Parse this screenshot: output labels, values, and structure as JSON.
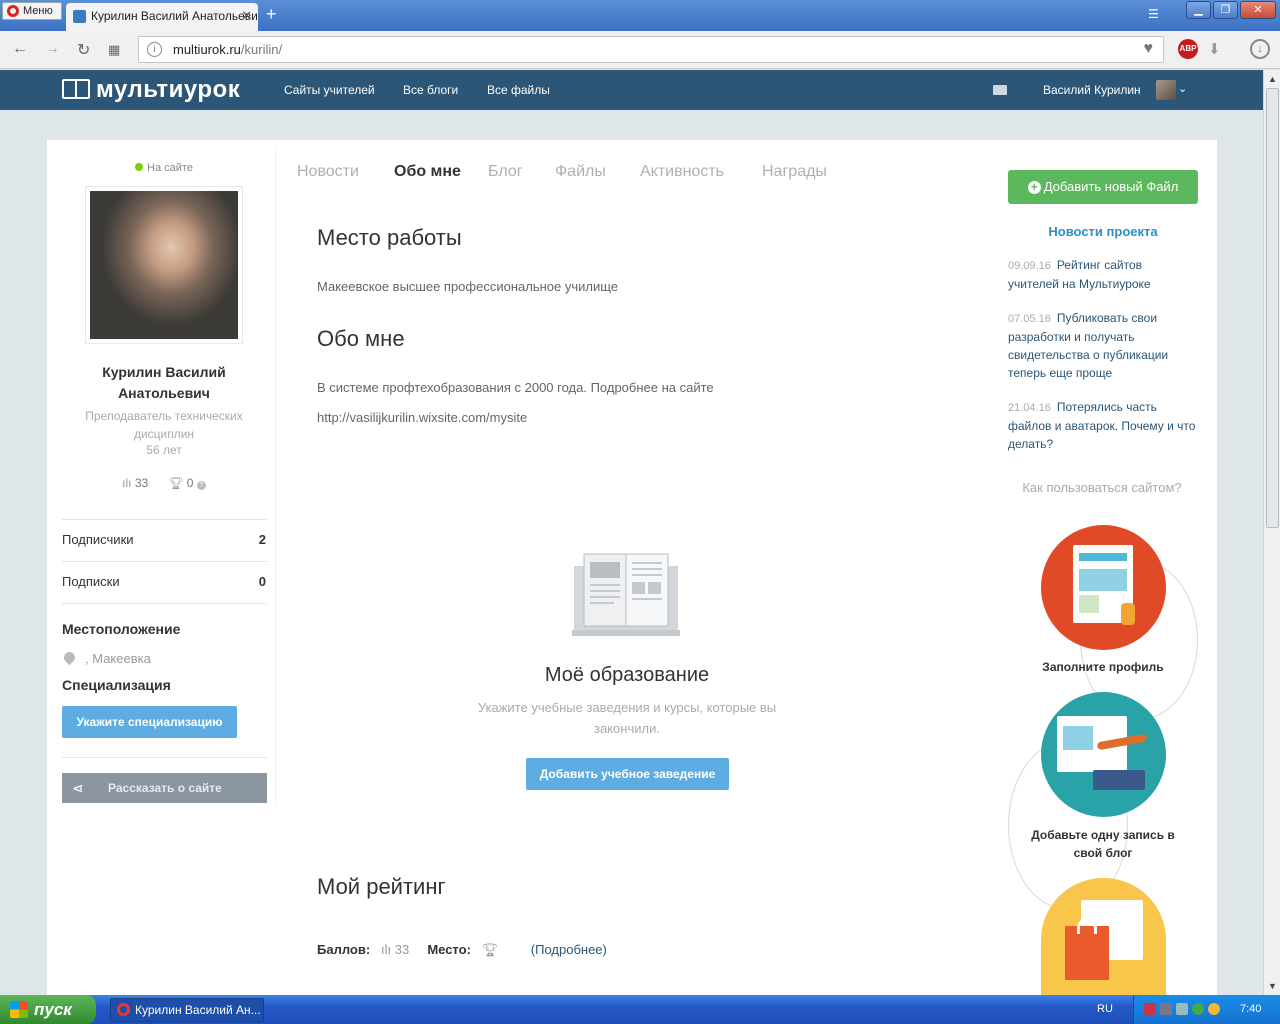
{
  "browser": {
    "menu_label": "Меню",
    "tab_title": "Курилин Василий Анатольевич",
    "url_host": "multiurok.ru",
    "url_path": "/kurilin/",
    "abp_label": "ABP"
  },
  "site": {
    "logo": "мультиурок",
    "nav": [
      "Сайты учителей",
      "Все блоги",
      "Все файлы"
    ],
    "user_name": "Василий Курилин"
  },
  "profile": {
    "status": "На сайте",
    "full_name": "Курилин Василий Анатольевич",
    "position": "Преподаватель технических дисциплин",
    "age": "56 лет",
    "rating_points": "33",
    "awards": "0",
    "subscribers_label": "Подписчики",
    "subscribers_count": "2",
    "subscriptions_label": "Подписки",
    "subscriptions_count": "0",
    "location_heading": "Местоположение",
    "location": ", Макеевка",
    "specialization_heading": "Специализация",
    "specialization_button": "Укажите специализацию",
    "share_button": "Рассказать о сайте"
  },
  "tabs": [
    "Новости",
    "Обо мне",
    "Блог",
    "Файлы",
    "Активность",
    "Награды"
  ],
  "active_tab": "Обо мне",
  "main": {
    "work_heading": "Место работы",
    "work_text": "Макеевское высшее профессиональное училище",
    "about_heading": "Обо мне",
    "about_text": "В системе профтехобразования с 2000 года. Подробнее на сайте",
    "about_link": "http://vasilijkurilin.wixsite.com/mysite",
    "education_title": "Моё образование",
    "education_text": "Укажите учебные заведения и курсы, которые вы закончили.",
    "education_button": "Добавить учебное заведение",
    "rating_heading": "Мой рейтинг",
    "points_label": "Баллов:",
    "points_value": "33",
    "place_label": "Место:",
    "details_link": "(Подробнее)"
  },
  "sidebar": {
    "add_file_button": "Добавить новый Файл",
    "news_title": "Новости проекта",
    "news": [
      {
        "date": "09.09.16",
        "text": "Рейтинг сайтов учителей на Мультиуроке"
      },
      {
        "date": "07.05.16",
        "text": "Публиковать свои разработки и получать свидетельства о публикации теперь еще проще"
      },
      {
        "date": "21.04.16",
        "text": "Потерялись часть файлов и аватарок. Почему и что делать?"
      }
    ],
    "howto_link": "Как пользоваться сайтом?",
    "steps": [
      "Заполните профиль",
      "Добавьте одну запись в свой блог"
    ]
  },
  "taskbar": {
    "start_label": "пуск",
    "task_item": "Курилин Василий Ан...",
    "lang": "RU",
    "clock": "7:40"
  },
  "colors": {
    "header_bg": "#2b5677",
    "accent_blue": "#5dade2",
    "add_button_green": "#5cb85c",
    "online_dot": "#7bd000"
  }
}
